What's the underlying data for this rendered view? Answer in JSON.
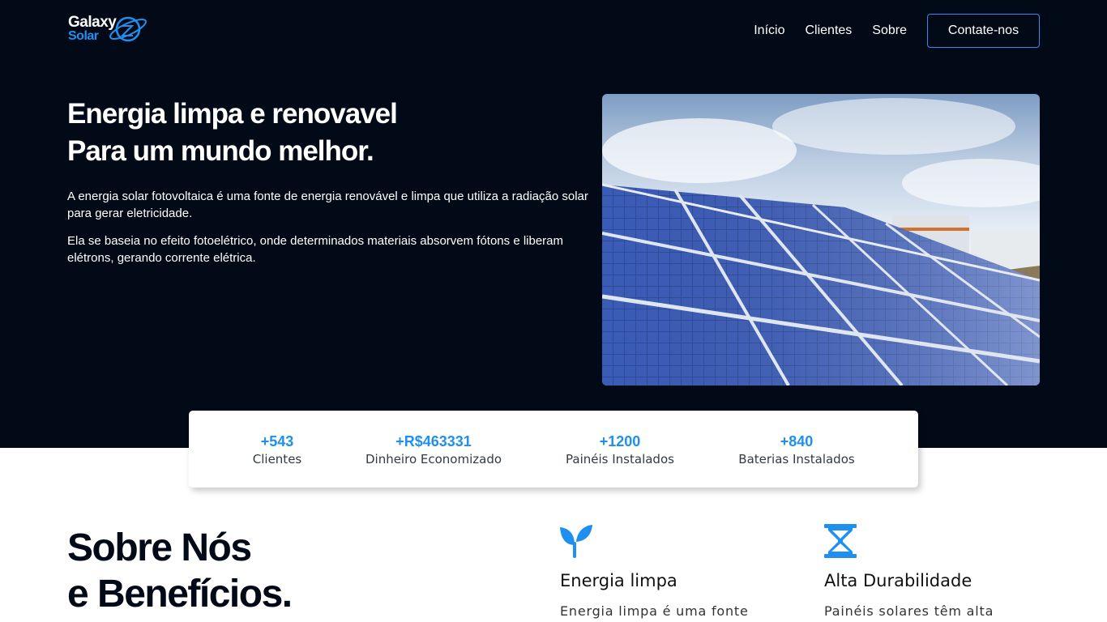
{
  "brand": {
    "line1": "Galaxy",
    "line2": "Solar",
    "accent_color": "#1f8ff0",
    "hero_bg": "#030a17"
  },
  "nav": {
    "items": [
      {
        "label": "Início"
      },
      {
        "label": "Clientes"
      },
      {
        "label": "Sobre"
      }
    ],
    "cta": "Contate-nos"
  },
  "hero": {
    "title_line1": "Energia limpa e renovavel",
    "title_line2": "Para um mundo melhor.",
    "paragraph1": "A energia solar fotovoltaica é uma fonte de energia renovável e limpa que utiliza a radiação solar para gerar eletricidade.",
    "paragraph2": "Ela se baseia no efeito fotoelétrico, onde determinados materiais absorvem fótons e liberam elétrons, gerando corrente elétrica.",
    "image": "solar-panels-photo"
  },
  "stats": [
    {
      "value": "+543",
      "label": "Clientes"
    },
    {
      "value": "+R$463331",
      "label": "Dinheiro Economizado"
    },
    {
      "value": "+1200",
      "label": "Painéis Instalados"
    },
    {
      "value": "+840",
      "label": "Baterias Instalados"
    }
  ],
  "about": {
    "title_line1": "Sobre Nós",
    "title_line2": "e Benefícios.",
    "benefits": [
      {
        "icon": "sprout-icon",
        "title": "Energia limpa",
        "text": "Energia limpa é uma fonte"
      },
      {
        "icon": "hourglass-icon",
        "title": "Alta Durabilidade",
        "text": "Painéis solares têm alta"
      }
    ]
  }
}
